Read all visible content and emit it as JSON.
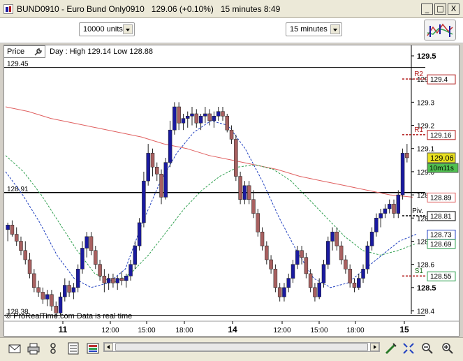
{
  "window": {
    "title": "BUND0910 - Euro Bund Only0910",
    "last": "129.06 (+0.10%)",
    "interval": "15 minutes",
    "clock": "8:49",
    "minimize": "_",
    "maximize": "□",
    "close": "X"
  },
  "toolbar": {
    "size_value": "10000 units",
    "timeframe_value": "15 minutes"
  },
  "chart": {
    "price_tab": "Price",
    "day_info": "Day : High 129.14 Low 128.88",
    "footer": "© ProRealTime.com  Data is real time",
    "level_top": "129.45",
    "level_mid": "128.91",
    "level_low": "128.38",
    "x_ticks": [
      "11",
      "12:00",
      "15:00",
      "18:00",
      "14",
      "12:00",
      "15:00",
      "18:00",
      "15"
    ],
    "y_ticks": [
      "129.5",
      "129.4",
      "129.3",
      "129.2",
      "129.1",
      "129.0",
      "128.9",
      "128.8",
      "128.7",
      "128.6",
      "128.5",
      "128.4"
    ],
    "pivots": [
      {
        "name": "R2",
        "value": "129.4"
      },
      {
        "name": "R1",
        "value": "129.16"
      },
      {
        "name": "Piv.",
        "value": "128.81"
      },
      {
        "name": "S1",
        "value": "128.55"
      }
    ],
    "tags": {
      "price": "129.06",
      "timer": "10m11s",
      "red_ma": "128.89",
      "blue_ma": "128.73",
      "green_ma": "128.69"
    }
  },
  "colors": {
    "up_candle": "#1a1aa0",
    "down_candle": "#a86060",
    "pivot": "#b01818",
    "ma_red": "#e06060",
    "ma_blue": "#2040c0",
    "ma_green": "#30a050",
    "price_tag_bg": "#e8e020",
    "timer_tag_bg": "#50c050"
  },
  "chart_data": {
    "type": "candlestick",
    "y_range": [
      128.36,
      129.52
    ],
    "reference_levels": [
      129.45,
      128.91,
      128.38
    ],
    "candles": [
      [
        128.75,
        128.78,
        128.7,
        128.77
      ],
      [
        128.77,
        128.79,
        128.72,
        128.73
      ],
      [
        128.73,
        128.76,
        128.68,
        128.7
      ],
      [
        128.7,
        128.72,
        128.64,
        128.66
      ],
      [
        128.66,
        128.7,
        128.6,
        128.62
      ],
      [
        128.62,
        128.65,
        128.54,
        128.56
      ],
      [
        128.56,
        128.58,
        128.48,
        128.5
      ],
      [
        128.5,
        128.53,
        128.46,
        128.48
      ],
      [
        128.48,
        128.5,
        128.43,
        128.45
      ],
      [
        128.45,
        128.49,
        128.42,
        128.47
      ],
      [
        128.47,
        128.49,
        128.4,
        128.42
      ],
      [
        128.42,
        128.44,
        128.37,
        128.39
      ],
      [
        128.39,
        128.48,
        128.38,
        128.46
      ],
      [
        128.46,
        128.54,
        128.44,
        128.51
      ],
      [
        128.51,
        128.53,
        128.46,
        128.48
      ],
      [
        128.48,
        128.52,
        128.45,
        128.5
      ],
      [
        128.5,
        128.6,
        128.48,
        128.58
      ],
      [
        128.58,
        128.7,
        128.56,
        128.67
      ],
      [
        128.67,
        128.74,
        128.63,
        128.72
      ],
      [
        128.72,
        128.74,
        128.64,
        128.66
      ],
      [
        128.66,
        128.68,
        128.58,
        128.6
      ],
      [
        128.6,
        128.62,
        128.53,
        128.55
      ],
      [
        128.55,
        128.58,
        128.48,
        128.52
      ],
      [
        128.52,
        128.56,
        128.49,
        128.54
      ],
      [
        128.54,
        128.56,
        128.5,
        128.52
      ],
      [
        128.52,
        128.55,
        128.49,
        128.54
      ],
      [
        128.54,
        128.57,
        128.51,
        128.53
      ],
      [
        128.53,
        128.56,
        128.5,
        128.55
      ],
      [
        128.55,
        128.62,
        128.53,
        128.6
      ],
      [
        128.6,
        128.7,
        128.58,
        128.68
      ],
      [
        128.68,
        128.8,
        128.66,
        128.78
      ],
      [
        128.78,
        129.0,
        128.76,
        128.96
      ],
      [
        128.96,
        129.12,
        128.94,
        129.08
      ],
      [
        129.08,
        129.1,
        128.98,
        129.02
      ],
      [
        129.02,
        129.04,
        128.96,
        128.99
      ],
      [
        128.99,
        129.01,
        128.86,
        128.89
      ],
      [
        128.89,
        129.06,
        128.88,
        129.04
      ],
      [
        129.04,
        129.22,
        129.02,
        129.18
      ],
      [
        129.18,
        129.3,
        129.16,
        129.28
      ],
      [
        129.28,
        129.3,
        129.18,
        129.21
      ],
      [
        129.21,
        129.25,
        129.18,
        129.23
      ],
      [
        129.23,
        129.26,
        129.19,
        129.24
      ],
      [
        129.24,
        129.28,
        129.2,
        129.25
      ],
      [
        129.25,
        129.27,
        129.19,
        129.21
      ],
      [
        129.21,
        129.25,
        129.18,
        129.24
      ],
      [
        129.24,
        129.28,
        129.21,
        129.25
      ],
      [
        129.25,
        129.27,
        129.2,
        129.22
      ],
      [
        129.22,
        129.26,
        129.19,
        129.24
      ],
      [
        129.24,
        129.28,
        129.22,
        129.26
      ],
      [
        129.26,
        129.28,
        129.22,
        129.24
      ],
      [
        129.24,
        129.25,
        129.17,
        129.18
      ],
      [
        129.18,
        129.2,
        129.12,
        129.14
      ],
      [
        129.14,
        129.16,
        128.96,
        128.98
      ],
      [
        128.98,
        129.0,
        128.86,
        128.88
      ],
      [
        128.88,
        128.96,
        128.86,
        128.94
      ],
      [
        128.94,
        128.96,
        128.86,
        128.88
      ],
      [
        128.88,
        128.92,
        128.8,
        128.82
      ],
      [
        128.82,
        128.84,
        128.72,
        128.74
      ],
      [
        128.74,
        128.76,
        128.66,
        128.68
      ],
      [
        128.68,
        128.7,
        128.6,
        128.62
      ],
      [
        128.62,
        128.64,
        128.56,
        128.58
      ],
      [
        128.58,
        128.6,
        128.48,
        128.5
      ],
      [
        128.5,
        128.52,
        128.44,
        128.46
      ],
      [
        128.46,
        128.52,
        128.44,
        128.5
      ],
      [
        128.5,
        128.56,
        128.48,
        128.54
      ],
      [
        128.54,
        128.62,
        128.52,
        128.6
      ],
      [
        128.6,
        128.68,
        128.58,
        128.66
      ],
      [
        128.66,
        128.68,
        128.6,
        128.63
      ],
      [
        128.63,
        128.65,
        128.54,
        128.56
      ],
      [
        128.56,
        128.58,
        128.48,
        128.5
      ],
      [
        128.5,
        128.52,
        128.44,
        128.46
      ],
      [
        128.46,
        128.54,
        128.45,
        128.52
      ],
      [
        128.52,
        128.62,
        128.5,
        128.6
      ],
      [
        128.6,
        128.72,
        128.58,
        128.7
      ],
      [
        128.7,
        128.76,
        128.66,
        128.74
      ],
      [
        128.74,
        128.76,
        128.66,
        128.68
      ],
      [
        128.68,
        128.7,
        128.6,
        128.62
      ],
      [
        128.62,
        128.64,
        128.56,
        128.58
      ],
      [
        128.58,
        128.6,
        128.5,
        128.52
      ],
      [
        128.52,
        128.54,
        128.48,
        128.5
      ],
      [
        128.5,
        128.56,
        128.49,
        128.54
      ],
      [
        128.54,
        128.6,
        128.52,
        128.58
      ],
      [
        128.58,
        128.7,
        128.56,
        128.68
      ],
      [
        128.68,
        128.76,
        128.66,
        128.74
      ],
      [
        128.74,
        128.82,
        128.72,
        128.8
      ],
      [
        128.8,
        128.84,
        128.76,
        128.82
      ],
      [
        128.82,
        128.86,
        128.8,
        128.84
      ],
      [
        128.84,
        128.88,
        128.82,
        128.86
      ],
      [
        128.86,
        128.88,
        128.8,
        128.82
      ],
      [
        128.82,
        128.92,
        128.8,
        128.9
      ],
      [
        128.9,
        129.1,
        128.88,
        129.08
      ],
      [
        129.08,
        129.12,
        129.04,
        129.06
      ]
    ],
    "moving_averages": [
      {
        "name": "red",
        "values": [
          129.28,
          129.26,
          129.23,
          129.21,
          129.19,
          129.17,
          129.15,
          129.12,
          129.1,
          129.07,
          129.05,
          129.03,
          129.01,
          128.98,
          128.96,
          128.94,
          128.92,
          128.9,
          128.89
        ]
      },
      {
        "name": "blue",
        "values": [
          129.0,
          128.9,
          128.78,
          128.64,
          128.54,
          128.5,
          128.52,
          128.58,
          128.78,
          128.95,
          129.08,
          129.17,
          129.22,
          129.2,
          129.1,
          128.96,
          128.8,
          128.66,
          128.54,
          128.5,
          128.52,
          128.58,
          128.64,
          128.7,
          128.73
        ]
      },
      {
        "name": "green",
        "values": [
          129.07,
          129.0,
          128.9,
          128.78,
          128.66,
          128.56,
          128.52,
          128.56,
          128.64,
          128.74,
          128.84,
          128.92,
          128.98,
          129.02,
          129.03,
          129.01,
          128.96,
          128.88,
          128.8,
          128.72,
          128.66,
          128.64,
          128.66,
          128.69
        ]
      }
    ]
  }
}
